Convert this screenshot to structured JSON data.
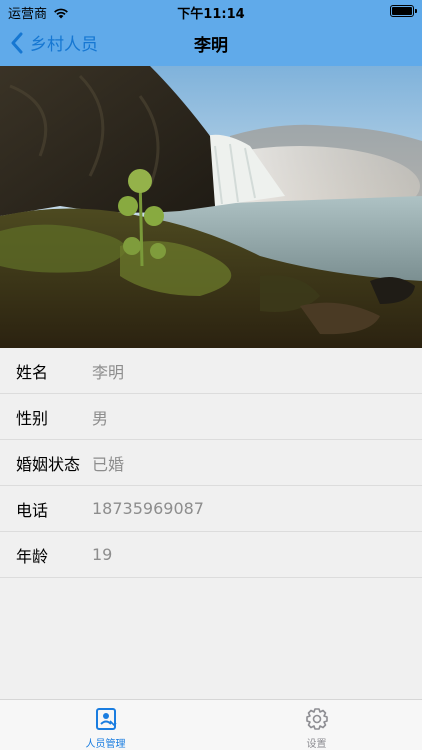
{
  "status_bar": {
    "carrier": "运营商",
    "time": "下午11:14"
  },
  "nav": {
    "back_label": "乡村人员",
    "title": "李明"
  },
  "hero": {
    "image_description": "waterfall landscape"
  },
  "info": {
    "rows": [
      {
        "label": "姓名",
        "value": "李明"
      },
      {
        "label": "性别",
        "value": "男"
      },
      {
        "label": "婚姻状态",
        "value": "已婚"
      },
      {
        "label": "电话",
        "value": "18735969087"
      },
      {
        "label": "年龄",
        "value": "19"
      }
    ]
  },
  "tabbar": {
    "tabs": [
      {
        "label": "人员管理",
        "icon": "person-card-icon",
        "active": true
      },
      {
        "label": "设置",
        "icon": "gear-icon",
        "active": false
      }
    ]
  },
  "colors": {
    "header": "#60aaea",
    "accent": "#1a7de0",
    "value_text": "#8d8d8d"
  }
}
